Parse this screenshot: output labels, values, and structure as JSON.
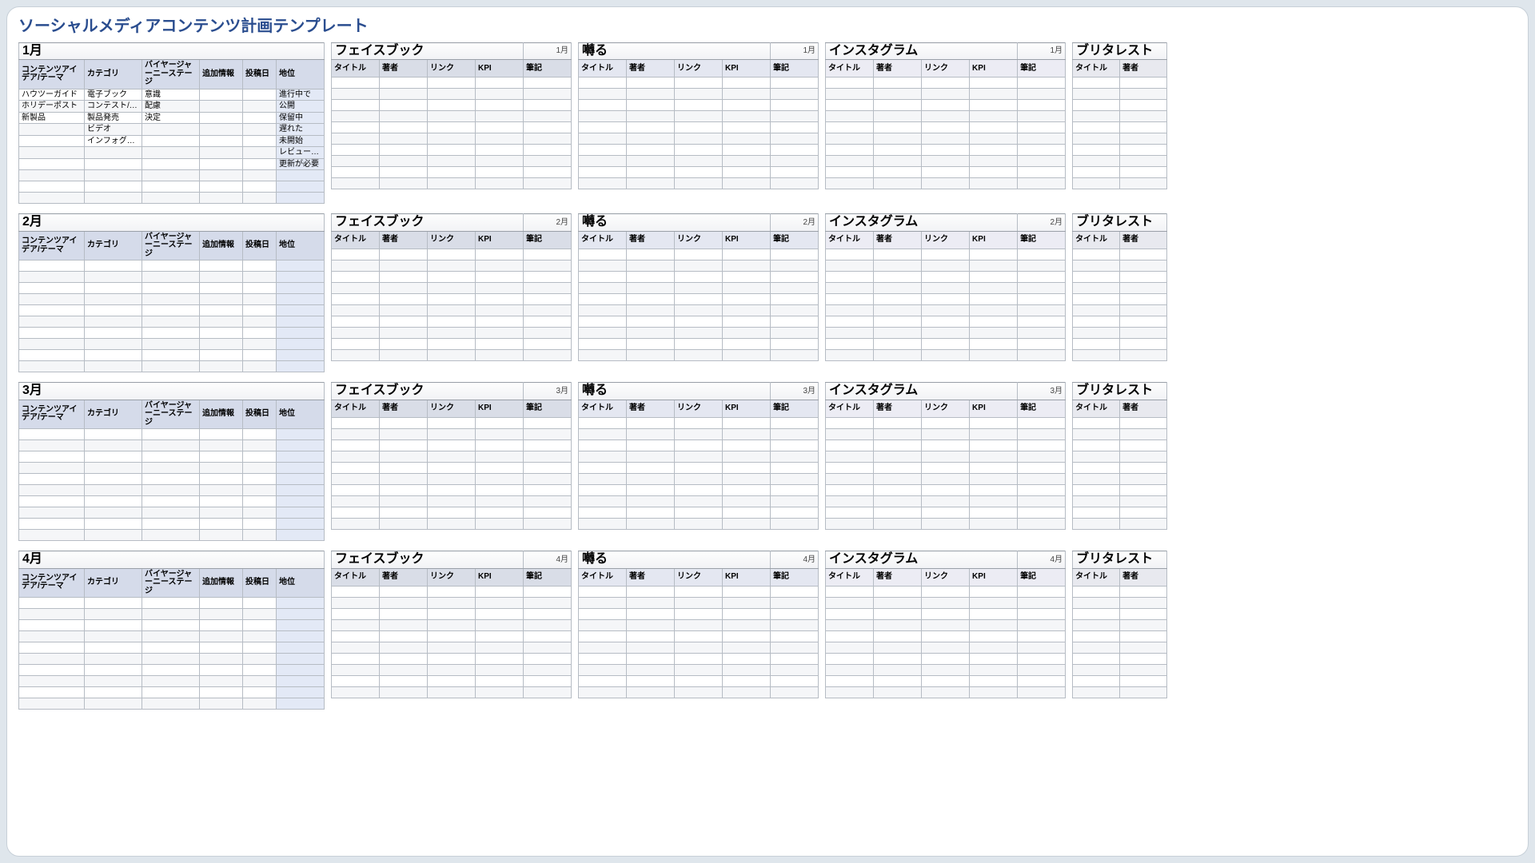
{
  "title": "ソーシャルメディアコンテンツ計画テンプレート",
  "body_rows_per_month": 10,
  "months": [
    {
      "label": "1月",
      "num": "1月"
    },
    {
      "label": "2月",
      "num": "2月"
    },
    {
      "label": "3月",
      "num": "3月"
    },
    {
      "label": "4月",
      "num": "4月"
    }
  ],
  "plan": {
    "headers": [
      "コンテンツアイデア/テーマ",
      "カテゴリ",
      "バイヤージャーニーステージ",
      "追加情報",
      "投稿日",
      "地位"
    ],
    "rows_month1": [
      [
        "ハウツーガイド",
        "電子ブック",
        "意識",
        "",
        "",
        "進行中で"
      ],
      [
        "ホリデーポスト",
        "コンテスト/景品",
        "配慮",
        "",
        "",
        "公開"
      ],
      [
        "新製品",
        "製品発売",
        "決定",
        "",
        "",
        "保留中"
      ],
      [
        "",
        "ビデオ",
        "",
        "",
        "",
        "遅れた"
      ],
      [
        "",
        "インフォグラフィック",
        "",
        "",
        "",
        "未開始"
      ],
      [
        "",
        "",
        "",
        "",
        "",
        "レビューが必要"
      ],
      [
        "",
        "",
        "",
        "",
        "",
        "更新が必要"
      ],
      [
        "",
        "",
        "",
        "",
        "",
        ""
      ],
      [
        "",
        "",
        "",
        "",
        "",
        ""
      ],
      [
        "",
        "",
        "",
        "",
        "",
        ""
      ]
    ]
  },
  "platforms": [
    {
      "key": "fb",
      "label": "フェイスブック"
    },
    {
      "key": "tw",
      "label": "囀る"
    },
    {
      "key": "ig",
      "label": "インスタグラム"
    }
  ],
  "platform_headers": [
    "タイトル",
    "著者",
    "リンク",
    "KPI",
    "筆記"
  ],
  "pinterest": {
    "label": "ブリタレスト",
    "headers": [
      "タイトル",
      "著者"
    ]
  }
}
